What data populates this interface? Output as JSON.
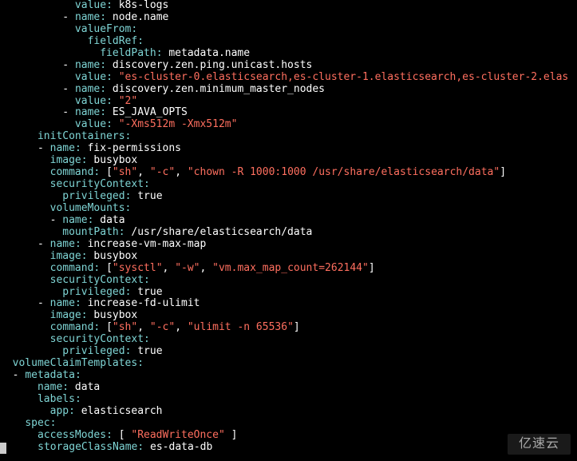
{
  "lines": [
    {
      "indent": 12,
      "key": "value",
      "colon": ":",
      "val": " k8s-logs"
    },
    {
      "indent": 10,
      "dash": "- ",
      "key": "name",
      "colon": ":",
      "val": " node.name"
    },
    {
      "indent": 12,
      "key": "valueFrom",
      "colon": ":",
      "val": ""
    },
    {
      "indent": 14,
      "key": "fieldRef",
      "colon": ":",
      "val": ""
    },
    {
      "indent": 16,
      "key": "fieldPath",
      "colon": ":",
      "val": " metadata.name"
    },
    {
      "indent": 10,
      "dash": "- ",
      "key": "name",
      "colon": ":",
      "val": " discovery.zen.ping.unicast.hosts"
    },
    {
      "indent": 12,
      "key": "value",
      "colon": ":",
      "val": " ",
      "str": "\"es-cluster-0.elasticsearch,es-cluster-1.elasticsearch,es-cluster-2.elas"
    },
    {
      "indent": 10,
      "dash": "- ",
      "key": "name",
      "colon": ":",
      "val": " discovery.zen.minimum_master_nodes"
    },
    {
      "indent": 12,
      "key": "value",
      "colon": ":",
      "val": " ",
      "str": "\"2\""
    },
    {
      "indent": 10,
      "dash": "- ",
      "key": "name",
      "colon": ":",
      "val": " ES_JAVA_OPTS"
    },
    {
      "indent": 12,
      "key": "value",
      "colon": ":",
      "val": " ",
      "str": "\"-Xms512m -Xmx512m\""
    },
    {
      "indent": 6,
      "key": "initContainers",
      "colon": ":",
      "val": ""
    },
    {
      "indent": 6,
      "dash": "- ",
      "key": "name",
      "colon": ":",
      "val": " fix-permissions"
    },
    {
      "indent": 8,
      "key": "image",
      "colon": ":",
      "val": " busybox"
    },
    {
      "indent": 8,
      "key": "command",
      "colon": ":",
      "val": " ",
      "arr": [
        "[",
        "\"sh\"",
        ", ",
        "\"-c\"",
        ", ",
        "\"chown -R 1000:1000 /usr/share/elasticsearch/data\"",
        "]"
      ]
    },
    {
      "indent": 8,
      "key": "securityContext",
      "colon": ":",
      "val": ""
    },
    {
      "indent": 10,
      "key": "privileged",
      "colon": ":",
      "val": " true"
    },
    {
      "indent": 8,
      "key": "volumeMounts",
      "colon": ":",
      "val": ""
    },
    {
      "indent": 8,
      "dash": "- ",
      "key": "name",
      "colon": ":",
      "val": " data"
    },
    {
      "indent": 10,
      "key": "mountPath",
      "colon": ":",
      "val": " /usr/share/elasticsearch/data"
    },
    {
      "indent": 6,
      "dash": "- ",
      "key": "name",
      "colon": ":",
      "val": " increase-vm-max-map"
    },
    {
      "indent": 8,
      "key": "image",
      "colon": ":",
      "val": " busybox"
    },
    {
      "indent": 8,
      "key": "command",
      "colon": ":",
      "val": " ",
      "arr": [
        "[",
        "\"sysctl\"",
        ", ",
        "\"-w\"",
        ", ",
        "\"vm.max_map_count=262144\"",
        "]"
      ]
    },
    {
      "indent": 8,
      "key": "securityContext",
      "colon": ":",
      "val": ""
    },
    {
      "indent": 10,
      "key": "privileged",
      "colon": ":",
      "val": " true"
    },
    {
      "indent": 6,
      "dash": "- ",
      "key": "name",
      "colon": ":",
      "val": " increase-fd-ulimit"
    },
    {
      "indent": 8,
      "key": "image",
      "colon": ":",
      "val": " busybox"
    },
    {
      "indent": 8,
      "key": "command",
      "colon": ":",
      "val": " ",
      "arr": [
        "[",
        "\"sh\"",
        ", ",
        "\"-c\"",
        ", ",
        "\"ulimit -n 65536\"",
        "]"
      ]
    },
    {
      "indent": 8,
      "key": "securityContext",
      "colon": ":",
      "val": ""
    },
    {
      "indent": 10,
      "key": "privileged",
      "colon": ":",
      "val": " true"
    },
    {
      "indent": 2,
      "key": "volumeClaimTemplates",
      "colon": ":",
      "val": ""
    },
    {
      "indent": 2,
      "dash": "- ",
      "key": "metadata",
      "colon": ":",
      "val": ""
    },
    {
      "indent": 6,
      "key": "name",
      "colon": ":",
      "val": " data"
    },
    {
      "indent": 6,
      "key": "labels",
      "colon": ":",
      "val": ""
    },
    {
      "indent": 8,
      "key": "app",
      "colon": ":",
      "val": " elasticsearch"
    },
    {
      "indent": 4,
      "key": "spec",
      "colon": ":",
      "val": ""
    },
    {
      "indent": 6,
      "key": "accessModes",
      "colon": ":",
      "val": " ",
      "arr": [
        "[ ",
        "\"ReadWriteOnce\"",
        " ]"
      ]
    },
    {
      "indent": 6,
      "key": "storageClassName",
      "colon": ":",
      "val": " es-data-db",
      "cursor": true
    }
  ],
  "watermark": "亿速云"
}
